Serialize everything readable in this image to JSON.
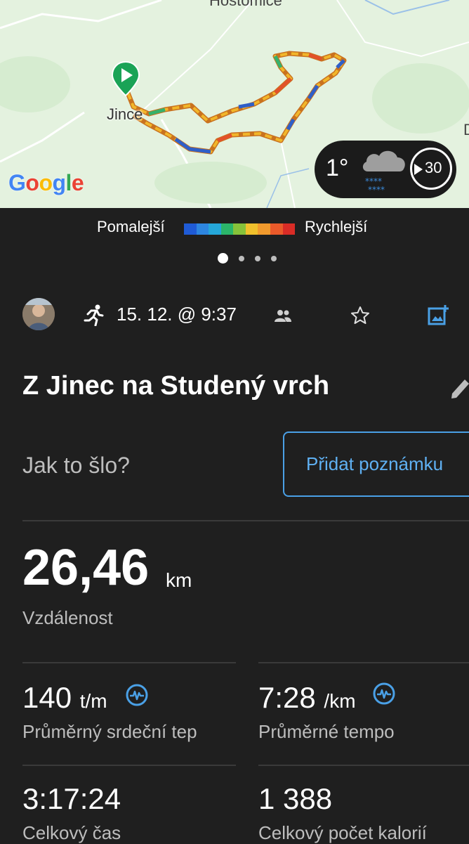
{
  "map": {
    "place_top": "Hostomice",
    "place_town": "Jince",
    "place_edge": "D",
    "attribution": [
      "G",
      "o",
      "o",
      "g",
      "l",
      "e"
    ],
    "attribution_colors": [
      "#4285F4",
      "#EA4335",
      "#FBBC05",
      "#4285F4",
      "#34A853",
      "#EA4335"
    ],
    "weather": {
      "temperature": "1°",
      "icon": "cloud-snow-icon",
      "wind_speed": "30"
    }
  },
  "legend": {
    "slow_label": "Pomalejší",
    "fast_label": "Rychlejší",
    "colors": [
      "#1f5bd6",
      "#2d86e0",
      "#25a7d9",
      "#2bb56a",
      "#86c23a",
      "#f0c02c",
      "#f19a2d",
      "#ea5a2a",
      "#d92c26"
    ]
  },
  "pager": {
    "pages": 4,
    "active": 0
  },
  "activity": {
    "date": "15. 12. @ 9:37",
    "type_icon": "running-icon",
    "title": "Z Jinec na Studený vrch",
    "prompt": "Jak to šlo?",
    "note_button": "Přidat poznámku"
  },
  "stats": {
    "distance": {
      "value": "26,46",
      "unit": "km",
      "label": "Vzdálenost"
    },
    "heart_rate": {
      "value": "140",
      "unit": "t/m",
      "label": "Průměrný srdeční tep"
    },
    "pace": {
      "value": "7:28",
      "unit": "/km",
      "label": "Průměrné tempo"
    },
    "time": {
      "value": "3:17:24",
      "label": "Celkový čas"
    },
    "calories": {
      "value": "1 388",
      "label": "Celkový počet kalorií"
    }
  }
}
